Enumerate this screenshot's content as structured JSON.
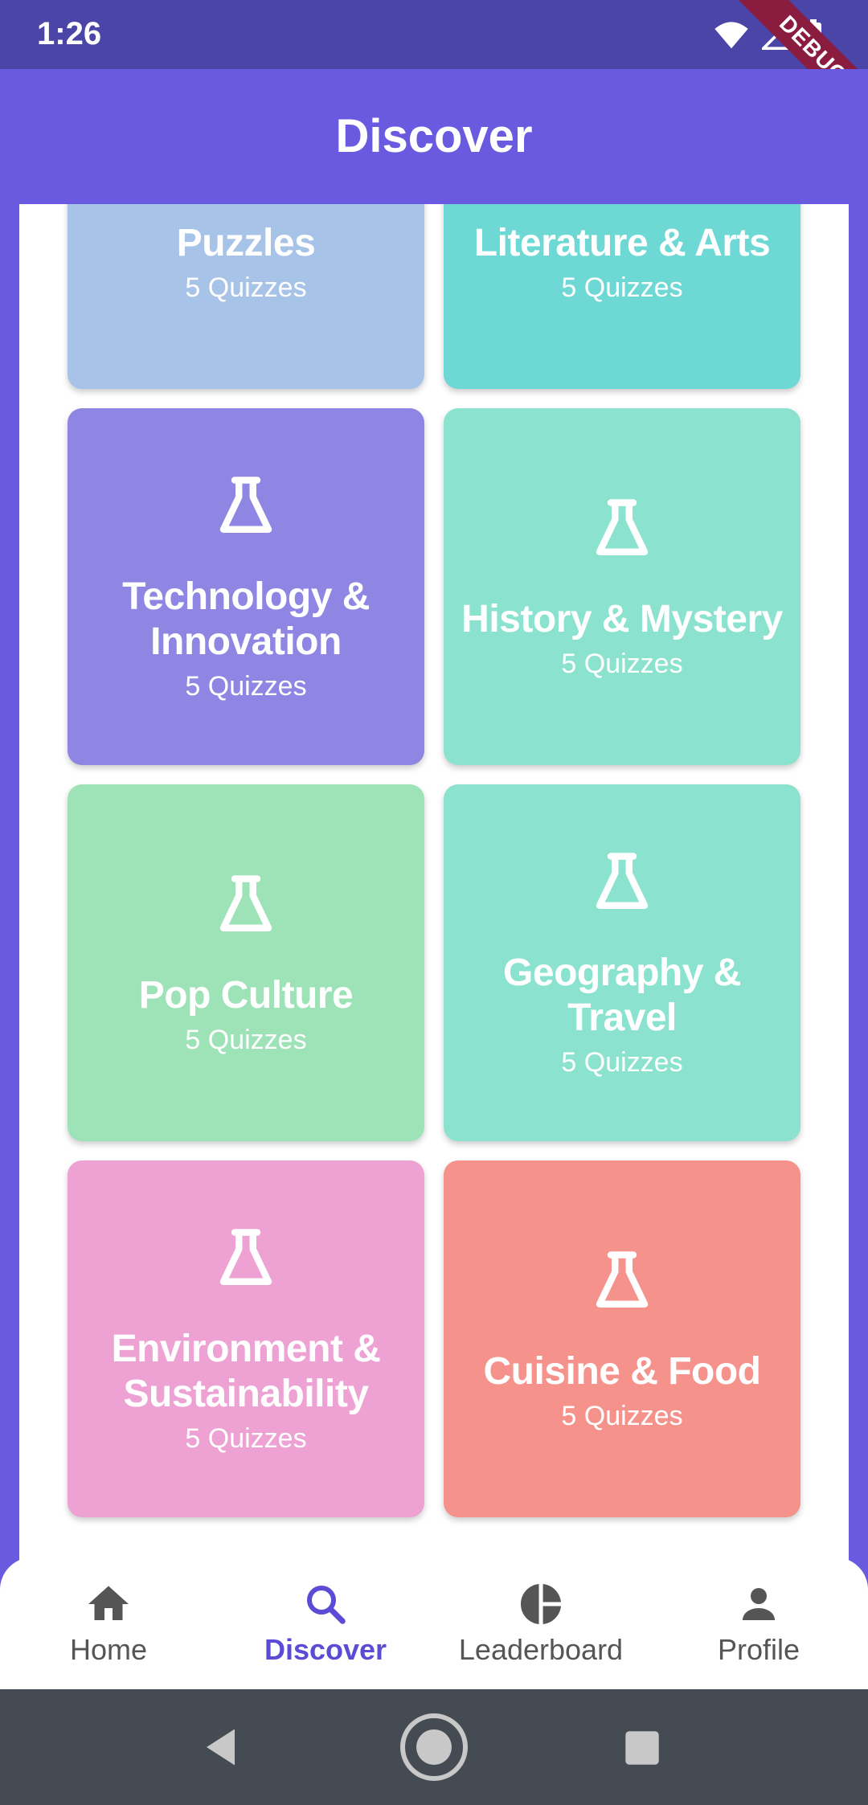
{
  "status_bar": {
    "time": "1:26",
    "battery": "76"
  },
  "debug_banner": "DEBUG",
  "app_bar": {
    "title": "Discover"
  },
  "categories": [
    {
      "title": "Puzzles",
      "count": "5 Quizzes",
      "color": "#a8c3e8"
    },
    {
      "title": "Literature & Arts",
      "count": "5 Quizzes",
      "color": "#6ed8d4"
    },
    {
      "title": "Technology & Innovation",
      "count": "5 Quizzes",
      "color": "#8f86e3"
    },
    {
      "title": "History & Mystery",
      "count": "5 Quizzes",
      "color": "#8be3cf"
    },
    {
      "title": "Pop Culture",
      "count": "5 Quizzes",
      "color": "#9ee3b8"
    },
    {
      "title": "Geography & Travel",
      "count": "5 Quizzes",
      "color": "#8be3cf"
    },
    {
      "title": "Environment & Sustainability",
      "count": "5 Quizzes",
      "color": "#eea1d3"
    },
    {
      "title": "Cuisine & Food",
      "count": "5 Quizzes",
      "color": "#f4928b"
    }
  ],
  "bottom_nav": [
    {
      "label": "Home",
      "icon": "home-icon",
      "active": false
    },
    {
      "label": "Discover",
      "icon": "search-icon",
      "active": true
    },
    {
      "label": "Leaderboard",
      "icon": "pie-chart-icon",
      "active": false
    },
    {
      "label": "Profile",
      "icon": "person-icon",
      "active": false
    }
  ],
  "colors": {
    "accent": "#6a5ae0",
    "active_nav": "#5b4bd5",
    "status_bar": "#4b45a7"
  }
}
